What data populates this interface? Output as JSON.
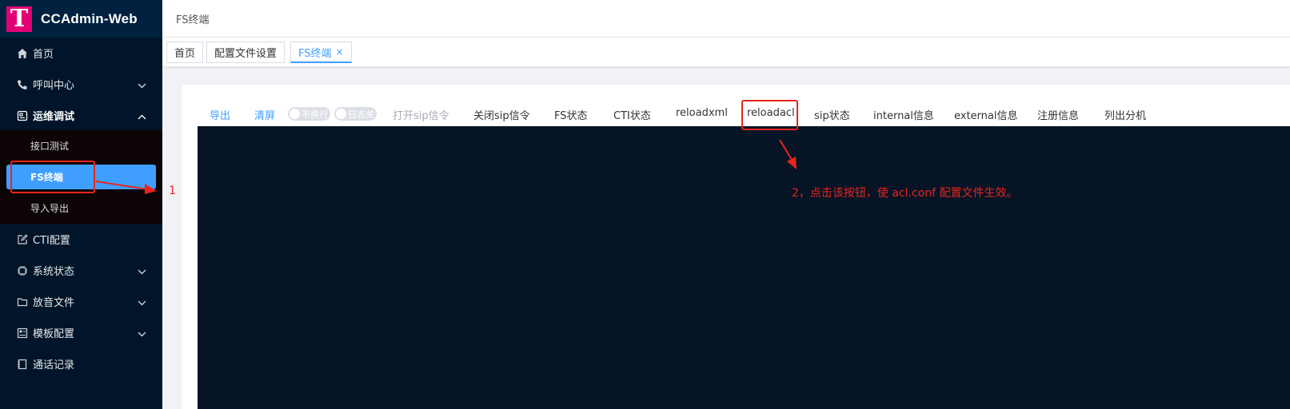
{
  "brand": {
    "logo_letter": "T",
    "name": "CCAdmin-Web",
    "logo_color": "#e20074"
  },
  "sidebar": {
    "items": [
      {
        "label": "首页",
        "icon": "home-icon"
      },
      {
        "label": "呼叫中心",
        "icon": "phone-icon"
      },
      {
        "label": "运维调试",
        "icon": "debug-icon"
      },
      {
        "label": "CTI配置",
        "icon": "edit-icon"
      },
      {
        "label": "系统状态",
        "icon": "chip-icon"
      },
      {
        "label": "放音文件",
        "icon": "folder-icon"
      },
      {
        "label": "模板配置",
        "icon": "template-icon"
      },
      {
        "label": "通话记录",
        "icon": "record-icon"
      }
    ],
    "submenu": [
      {
        "label": "接口测试"
      },
      {
        "label": "FS终端"
      },
      {
        "label": "导入导出"
      }
    ]
  },
  "header": {
    "breadcrumb": "FS终端"
  },
  "tabs": [
    {
      "label": "首页"
    },
    {
      "label": "配置文件设置"
    },
    {
      "label": "FS终端",
      "close": "×"
    }
  ],
  "toolbar": {
    "export": "导出",
    "clear": "清屏",
    "switch_wrap": "不换行",
    "switch_log": "日志关",
    "open_sip": "打开sip信令",
    "close_sip": "关闭sip信令",
    "fs_status": "FS状态",
    "cti_status": "CTI状态",
    "reloadxml": "reloadxml",
    "reloadacl": "reloadacl",
    "sip_status": "sip状态",
    "internal": "internal信息",
    "external": "external信息",
    "register": "注册信息",
    "list_ext": "列出分机"
  },
  "annotations": {
    "step1": "1",
    "step2": "2，点击该按钮，使 acl.conf 配置文件生效。",
    "color": "#e8251c"
  },
  "colors": {
    "accent": "#409eff",
    "sidebar_bg": "#001529",
    "terminal_bg": "#061426"
  }
}
